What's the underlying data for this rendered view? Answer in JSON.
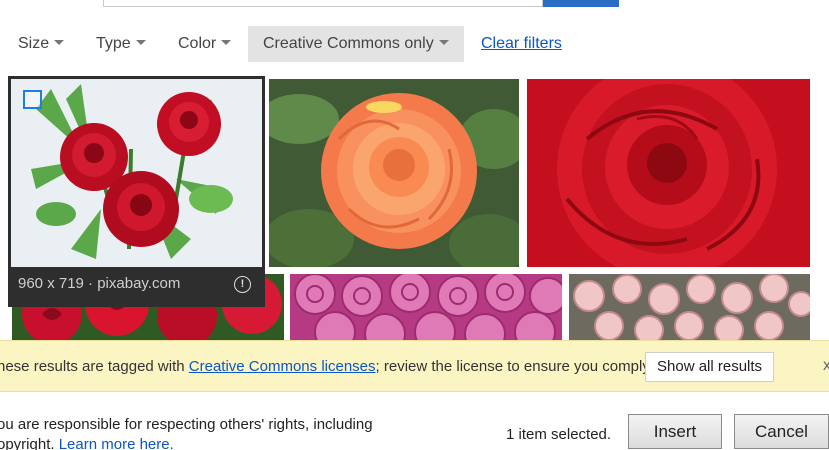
{
  "filters": {
    "size": "Size",
    "type": "Type",
    "color": "Color",
    "license": "Creative Commons only",
    "clear": "Clear filters"
  },
  "selected_image": {
    "caption": "960 x 719 · pixabay.com",
    "info_icon": "info-icon",
    "checkbox_icon": "checkbox-icon"
  },
  "images": [
    {
      "id": "rose-bouquet-red",
      "desc": "red roses with leaves"
    },
    {
      "id": "rose-orange",
      "desc": "orange rose"
    },
    {
      "id": "rose-red-closeup",
      "desc": "red rose closeup"
    },
    {
      "id": "roses-red-bunch",
      "desc": "red roses bunch"
    },
    {
      "id": "roses-pink-field",
      "desc": "pink roses"
    },
    {
      "id": "roses-pale-pink",
      "desc": "pale pink roses"
    }
  ],
  "banner": {
    "prefix": "hese results are tagged with ",
    "link": "Creative Commons licenses",
    "suffix": "; review the license to ensure you comply.",
    "show_all": "Show all results",
    "close": "x"
  },
  "footer": {
    "line1": "ou are responsible for respecting others' rights, including",
    "line2": "opyright. ",
    "link": "Learn more here.",
    "selected": "1 item selected.",
    "insert": "Insert",
    "cancel": "Cancel"
  },
  "colors": {
    "accent": "#0b57c6",
    "banner_bg": "#fbf4c3",
    "checkbox": "#1e7fe0"
  }
}
